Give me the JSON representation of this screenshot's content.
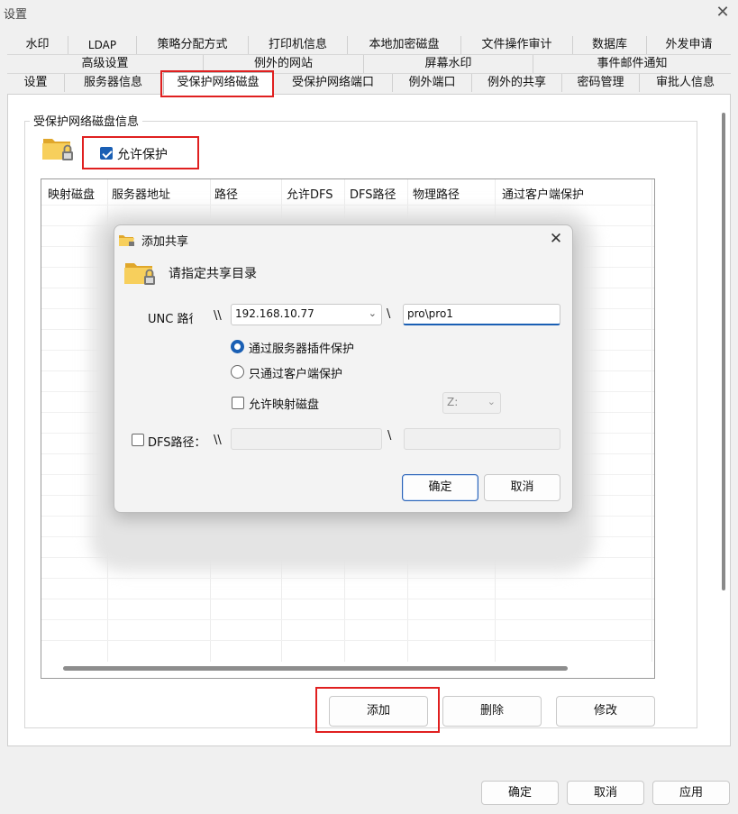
{
  "window": {
    "title": "设置",
    "close_symbol": "✕"
  },
  "tabs": {
    "row1": [
      "水印",
      "LDAP",
      "策略分配方式",
      "打印机信息",
      "本地加密磁盘",
      "文件操作审计",
      "数据库",
      "外发申请"
    ],
    "row2": [
      "高级设置",
      "例外的网站",
      "屏幕水印",
      "事件邮件通知"
    ],
    "row3": [
      "设置",
      "服务器信息",
      "受保护网络磁盘",
      "受保护网络端口",
      "例外端口",
      "例外的共享",
      "密码管理",
      "审批人信息"
    ],
    "active": "受保护网络磁盘"
  },
  "group": {
    "title": "受保护网络磁盘信息",
    "allow_protect_label": "允许保护",
    "allow_protect_checked": true
  },
  "table": {
    "columns": [
      "映射磁盘",
      "服务器地址",
      "路径",
      "允许DFS",
      "DFS路径",
      "物理路径",
      "通过客户端保护"
    ]
  },
  "panel_buttons": {
    "add": "添加",
    "delete": "删除",
    "modify": "修改"
  },
  "bottom_buttons": {
    "ok": "确定",
    "cancel": "取消",
    "apply": "应用"
  },
  "dialog": {
    "title": "添加共享",
    "close_symbol": "✕",
    "heading": "请指定共享目录",
    "unc_label": "UNC 路径",
    "backslash_double": "\\\\",
    "backslash_single": "\\",
    "server_value": "192.168.10.77",
    "path_value": "pro\\pro1",
    "radio_server_plugin": "通过服务器插件保护",
    "radio_client_only": "只通过客户端保护",
    "radio_selected": "server_plugin",
    "allow_map_drive": "允许映射磁盘",
    "drive_value": "Z:",
    "dfs_label": "DFS路径：",
    "ok": "确定",
    "cancel": "取消"
  },
  "colors": {
    "accent": "#1a5fb4",
    "highlight": "#e02020"
  }
}
